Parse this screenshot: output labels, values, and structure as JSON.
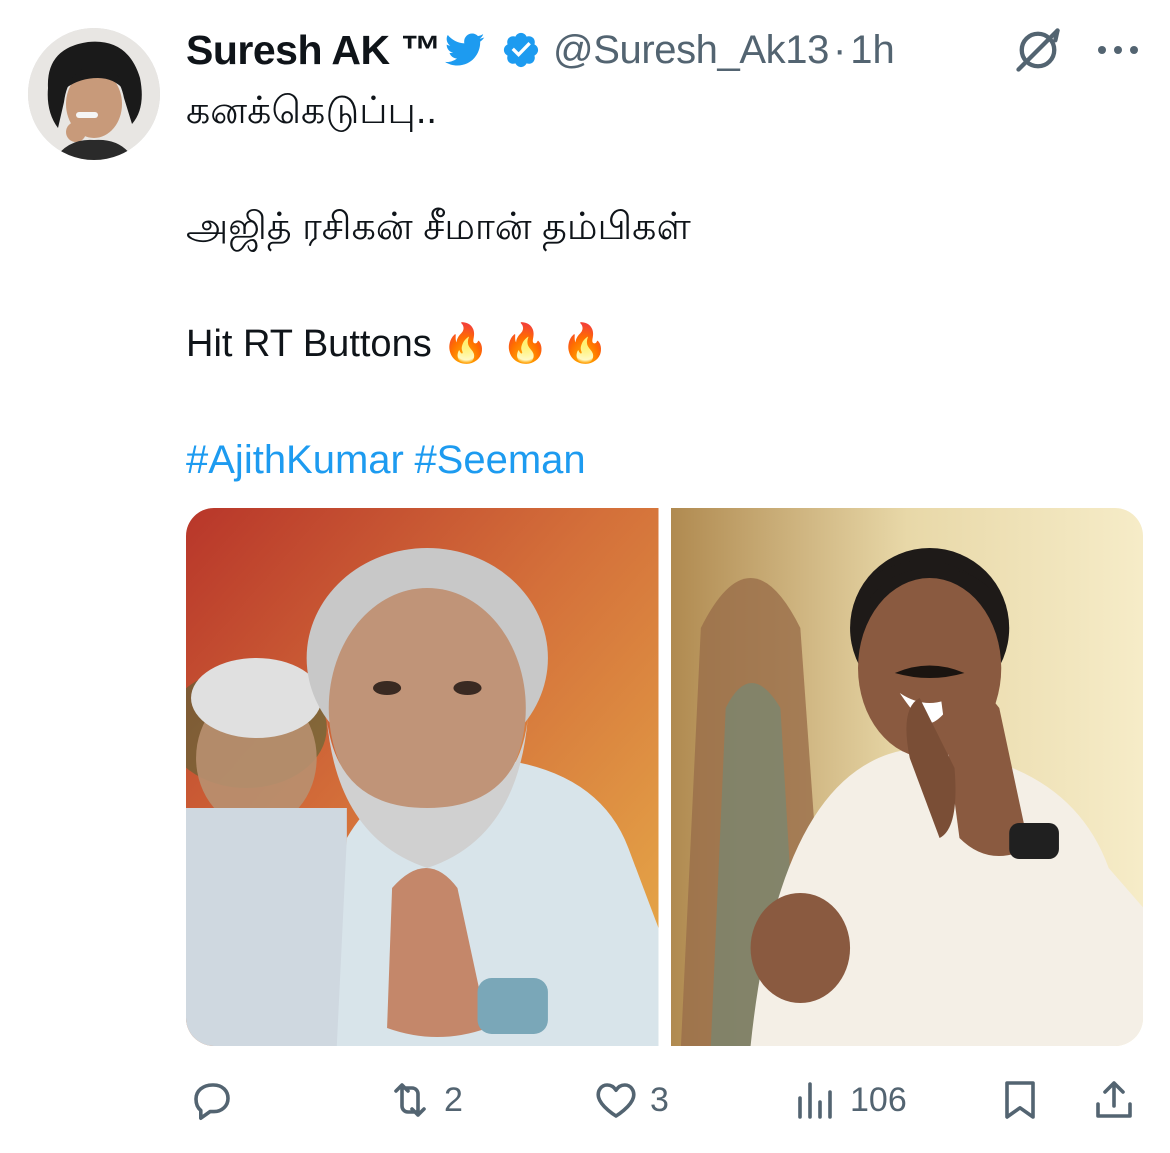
{
  "author": {
    "display_name": "Suresh AK ™",
    "handle": "@Suresh_Ak13",
    "separator": "·",
    "time": "1h",
    "verified_color": "#1d9bf0"
  },
  "tweet": {
    "lines": [
      "கனக்கெடுப்பு..",
      "அஜித் ரசிகன் சீமான் தம்பிகள்",
      "Hit RT Buttons"
    ],
    "emoji": "🔥 🔥 🔥",
    "hashtags": [
      "#AjithKumar",
      "#Seeman"
    ],
    "link_color": "#1d9bf0"
  },
  "actions": {
    "reply": {
      "icon": "reply-icon",
      "count": ""
    },
    "retweet": {
      "icon": "retweet-icon",
      "count": "2"
    },
    "like": {
      "icon": "heart-icon",
      "count": "3"
    },
    "views": {
      "icon": "views-icon",
      "count": "106"
    },
    "bookmark": {
      "icon": "bookmark-icon"
    },
    "share": {
      "icon": "share-icon"
    }
  },
  "colors": {
    "text": "#0f1419",
    "secondary": "#536471",
    "accent": "#1d9bf0",
    "twitter_bird": "#1d9bf0"
  }
}
